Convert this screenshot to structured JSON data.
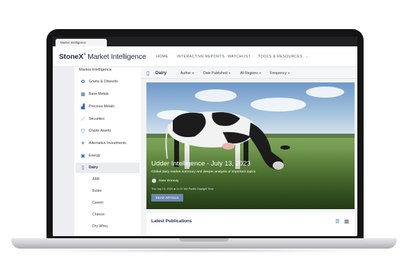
{
  "browser": {
    "tab_label": "Market Intelligence"
  },
  "header": {
    "logo_brand": "StoneX",
    "logo_suffix": "Market Intelligence",
    "nav": [
      "HOME",
      "INTERACTIVE REPORTS",
      "WATCHLIST",
      "TOOLS & RESOURCES"
    ]
  },
  "sidebar": {
    "title": "Market Intelligence",
    "items": [
      {
        "label": "Grains & Oilseeds",
        "icon": "wheat-icon"
      },
      {
        "label": "Base Metals",
        "icon": "metal-bars-icon"
      },
      {
        "label": "Precious Metals",
        "icon": "gold-bars-icon"
      },
      {
        "label": "Securities",
        "icon": "line-chart-icon"
      },
      {
        "label": "Crypto Assets",
        "icon": "crypto-icon"
      },
      {
        "label": "Alternative Investments",
        "icon": "network-icon"
      },
      {
        "label": "Energy",
        "icon": "energy-icon"
      },
      {
        "label": "Dairy",
        "icon": "milk-bottle-icon",
        "active": true
      }
    ],
    "subitems": [
      "AMF",
      "Butter",
      "Casein",
      "Cheese",
      "Dry Whey"
    ]
  },
  "filterbar": {
    "title": "Dairy",
    "filters": [
      "Author",
      "Date Published",
      "All Regions",
      "Frequency"
    ]
  },
  "hero": {
    "title": "Udder Intelligence - July 13, 2023",
    "subtitle": "Global dairy market summary and deeper analysis of important topics",
    "author": "Nate Donnay",
    "date": "Thu July 13, 2023 at 11:37 AM Pacific Daylight Time",
    "button": "READ ARTICLE"
  },
  "latest": {
    "title": "Latest Publications"
  },
  "colors": {
    "accent": "#2f63b5",
    "brand_navy": "#1f2b4d",
    "button": "#6d88ad"
  }
}
